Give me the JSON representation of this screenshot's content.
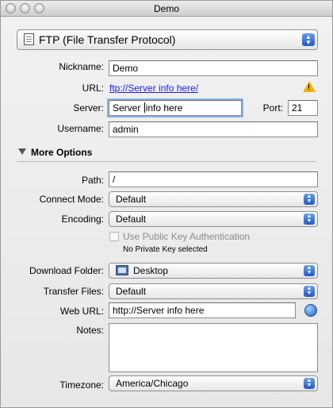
{
  "window": {
    "title": "Demo"
  },
  "protocol": {
    "selected": "FTP (File Transfer Protocol)"
  },
  "nickname": {
    "label": "Nickname:",
    "value": "Demo"
  },
  "url": {
    "label": "URL:",
    "value": "ftp://Server info here/"
  },
  "server": {
    "label": "Server:",
    "value_before_cursor": "Server ",
    "value_after_cursor": "info here"
  },
  "port": {
    "label": "Port:",
    "value": "21"
  },
  "username": {
    "label": "Username:",
    "value": "admin"
  },
  "more_options": {
    "label": "More Options"
  },
  "path": {
    "label": "Path:",
    "value": "/"
  },
  "connect_mode": {
    "label": "Connect Mode:",
    "selected": "Default"
  },
  "encoding": {
    "label": "Encoding:",
    "selected": "Default"
  },
  "public_key": {
    "label": "Use Public Key Authentication",
    "status": "No Private Key selected"
  },
  "download_folder": {
    "label": "Download Folder:",
    "selected": "Desktop"
  },
  "transfer_files": {
    "label": "Transfer Files:",
    "selected": "Default"
  },
  "web_url": {
    "label": "Web URL:",
    "value": "http://Server info here"
  },
  "notes": {
    "label": "Notes:",
    "value": ""
  },
  "timezone": {
    "label": "Timezone:",
    "selected": "America/Chicago"
  },
  "icons": [
    "close-button",
    "minimize-button",
    "zoom-button",
    "ftp-icon",
    "warning-icon",
    "disclosure-triangle-icon",
    "folder-icon",
    "globe-icon"
  ],
  "colors": {
    "link": "#1a1aff",
    "warning": "#f0b400",
    "stepper": "#2457c7"
  }
}
